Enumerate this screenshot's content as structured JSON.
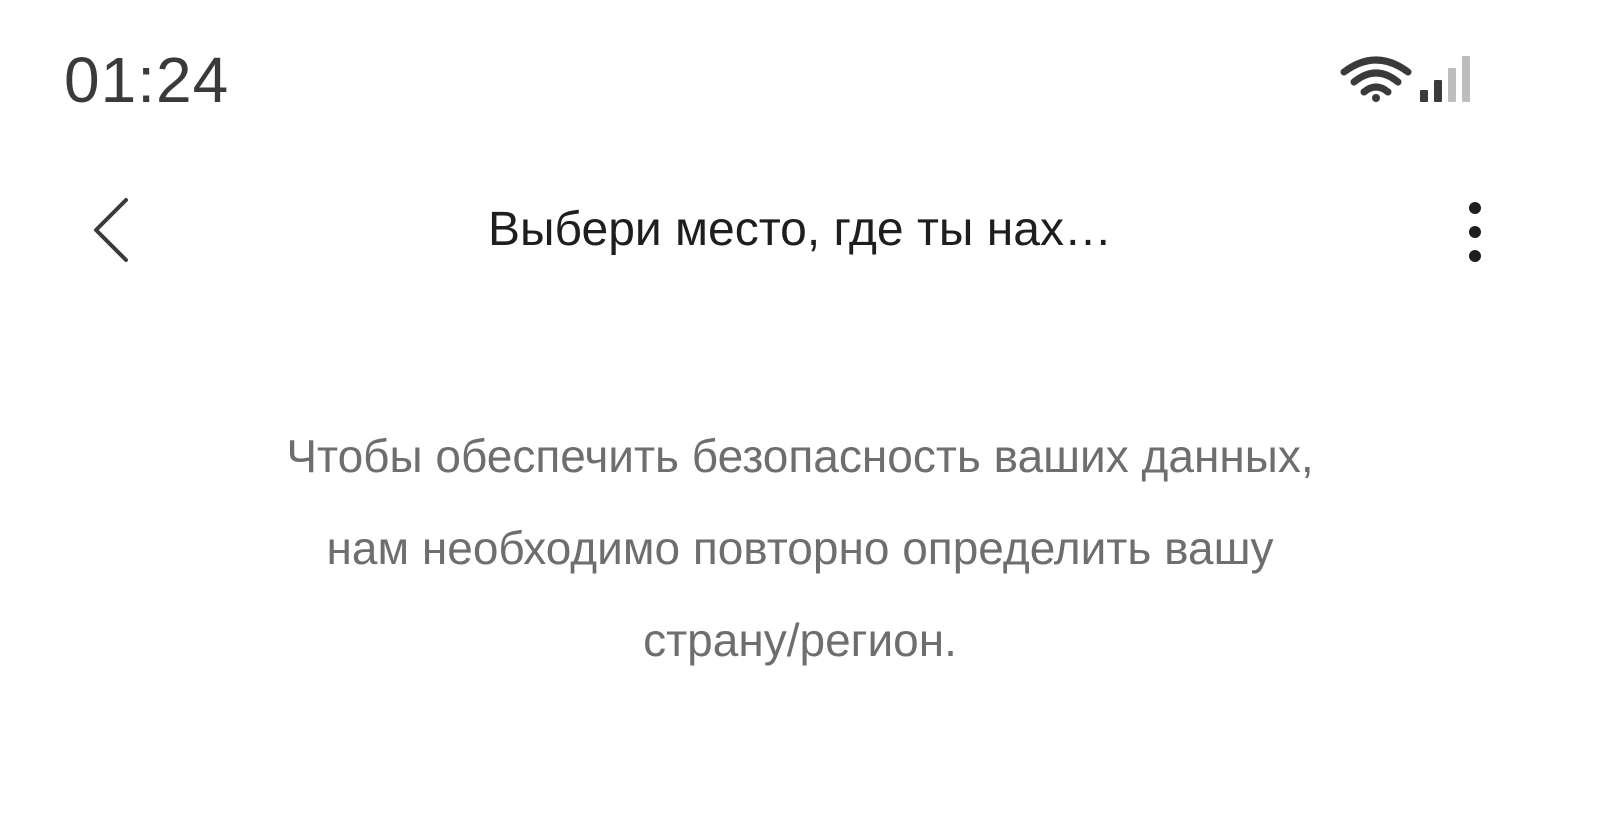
{
  "status_bar": {
    "time": "01:24",
    "icons": [
      "wifi-icon",
      "signal-icon"
    ]
  },
  "app_bar": {
    "back_icon": "chevron-left-icon",
    "title": "Выбери место, где ты нах…",
    "more_icon": "more-vertical-icon"
  },
  "main": {
    "message_lines": [
      "Чтобы обеспечить безопасность ваших данных,",
      "нам необходимо повторно определить вашу",
      "страну/регион."
    ]
  },
  "colors": {
    "background": "#ffffff",
    "title_text": "#1e1e1e",
    "body_text": "#6e6e6e",
    "status_text": "#3a3a3a"
  }
}
